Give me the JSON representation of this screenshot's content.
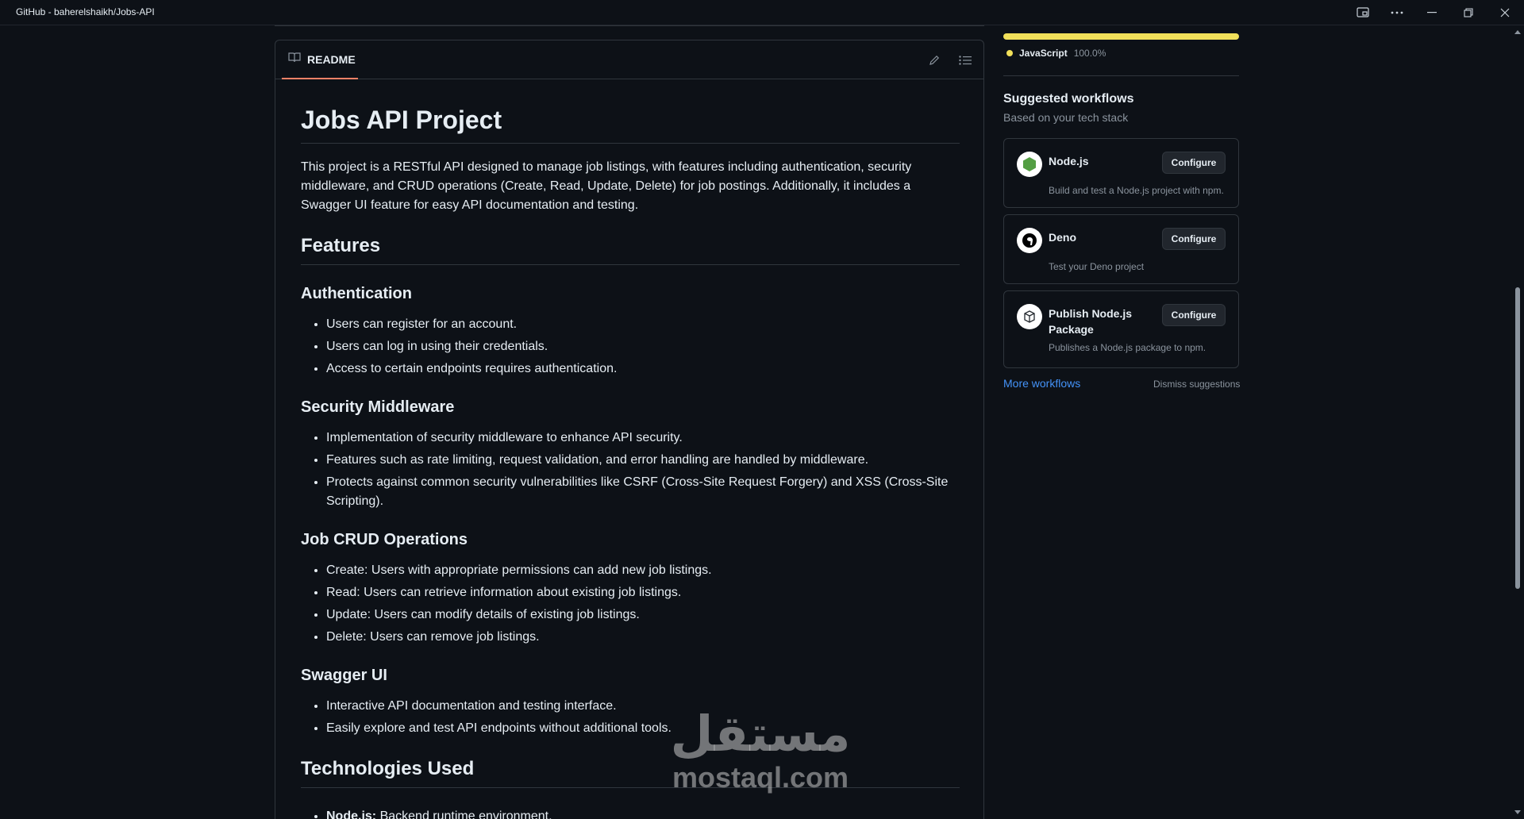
{
  "window": {
    "title": "GitHub - baherelshaikh/Jobs-API"
  },
  "readme": {
    "tab_label": "README",
    "heading": "Jobs API Project",
    "intro": "This project is a RESTful API designed to manage job listings, with features including authentication, security middleware, and CRUD operations (Create, Read, Update, Delete) for job postings. Additionally, it includes a Swagger UI feature for easy API documentation and testing.",
    "features_heading": "Features",
    "sections": [
      {
        "title": "Authentication",
        "items": [
          "Users can register for an account.",
          "Users can log in using their credentials.",
          "Access to certain endpoints requires authentication."
        ]
      },
      {
        "title": "Security Middleware",
        "items": [
          "Implementation of security middleware to enhance API security.",
          "Features such as rate limiting, request validation, and error handling are handled by middleware.",
          "Protects against common security vulnerabilities like CSRF (Cross-Site Request Forgery) and XSS (Cross-Site Scripting)."
        ]
      },
      {
        "title": "Job CRUD Operations",
        "items": [
          "Create: Users with appropriate permissions can add new job listings.",
          "Read: Users can retrieve information about existing job listings.",
          "Update: Users can modify details of existing job listings.",
          "Delete: Users can remove job listings."
        ]
      },
      {
        "title": "Swagger UI",
        "items": [
          "Interactive API documentation and testing interface.",
          "Easily explore and test API endpoints without additional tools."
        ]
      }
    ],
    "tech_heading": "Technologies Used",
    "tech_items": [
      {
        "name": "Node.js:",
        "desc": " Backend runtime environment."
      }
    ]
  },
  "languages": {
    "items": [
      {
        "name": "JavaScript",
        "percent": "100.0%",
        "color": "#f1e05a"
      }
    ]
  },
  "suggested_workflows": {
    "title": "Suggested workflows",
    "subtitle": "Based on your tech stack",
    "configure_label": "Configure",
    "items": [
      {
        "name": "Node.js",
        "description": "Build and test a Node.js project with npm.",
        "icon": "nodejs-icon"
      },
      {
        "name": "Deno",
        "description": "Test your Deno project",
        "icon": "deno-icon"
      },
      {
        "name": "Publish Node.js Package",
        "description": "Publishes a Node.js package to npm.",
        "icon": "package-icon"
      }
    ],
    "more_label": "More workflows",
    "dismiss_label": "Dismiss suggestions"
  },
  "watermark": {
    "arabic": "مستقل",
    "latin": "mostaql.com"
  },
  "colors": {
    "background": "#0d1117",
    "border": "#30363d",
    "accent_tab": "#f78166",
    "link": "#4493f8",
    "muted": "#8b949e"
  }
}
